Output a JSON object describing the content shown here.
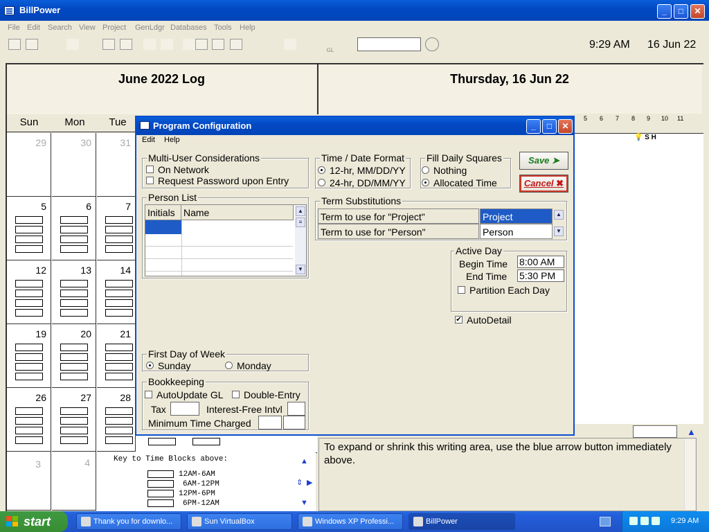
{
  "app": {
    "title": "BillPower",
    "time": "9:29 AM",
    "date": "16 Jun 22"
  },
  "menu": [
    "File",
    "Edit",
    "Search",
    "View",
    "Project",
    "GenLdgr",
    "Databases",
    "Tools",
    "Help"
  ],
  "toolbar": {
    "gl_label": "GL"
  },
  "log": {
    "title": "June 2022 Log"
  },
  "day": {
    "title": "Thursday, 16 Jun 22"
  },
  "weekdays": [
    "Sun",
    "Mon",
    "Tue"
  ],
  "calendar": {
    "row1": [
      "29",
      "30",
      "31"
    ],
    "row2": [
      "5",
      "6",
      "7"
    ],
    "row3": [
      "12",
      "13",
      "14"
    ],
    "row4": [
      "19",
      "20",
      "21"
    ],
    "row5": [
      "26",
      "27",
      "28"
    ],
    "row6": [
      "3",
      "4"
    ]
  },
  "key": {
    "title": "Key to Time Blocks above:",
    "blocks": [
      "12AM-6AM",
      "6AM-12PM",
      "12PM-6PM",
      "6PM-12AM"
    ]
  },
  "hours": [
    "5",
    "6",
    "7",
    "8",
    "9",
    "10",
    "11"
  ],
  "day_icons": "S  H",
  "writing": {
    "hint": "To expand or shrink this writing area, use the blue arrow button immediately above."
  },
  "dialog": {
    "title": "Program Configuration",
    "menu": [
      "Edit",
      "Help"
    ],
    "multi_user": {
      "label": "Multi-User Considerations",
      "on_network": "On Network",
      "request_password": "Request Password upon Entry"
    },
    "time_format": {
      "label": "Time / Date Format",
      "opt1": "12-hr, MM/DD/YY",
      "opt2": "24-hr, DD/MM/YY"
    },
    "fill_squares": {
      "label": "Fill Daily Squares",
      "opt1": "Nothing",
      "opt2": "Allocated Time"
    },
    "buttons": {
      "save": "Save",
      "cancel": "Cancel"
    },
    "person_list": {
      "label": "Person List",
      "col1": "Initials",
      "col2": "Name"
    },
    "terms": {
      "label": "Term Substitutions",
      "rows": [
        {
          "label": "Term to use for \"Project\"",
          "value": "Project"
        },
        {
          "label": "Term to use for \"Person\"",
          "value": "Person"
        }
      ]
    },
    "active_day": {
      "label": "Active Day",
      "begin_label": "Begin Time",
      "begin_value": "8:00 AM",
      "end_label": "End Time",
      "end_value": "5:30 PM",
      "partition": "Partition Each Day"
    },
    "autodetail": "AutoDetail",
    "first_day": {
      "label": "First Day of Week",
      "opt1": "Sunday",
      "opt2": "Monday"
    },
    "bookkeeping": {
      "label": "Bookkeeping",
      "autoupdate": "AutoUpdate GL",
      "double_entry": "Double-Entry",
      "tax": "Tax",
      "interest": "Interest-Free Intvl",
      "min_time": "Minimum Time Charged"
    }
  },
  "taskbar": {
    "start": "start",
    "tasks": [
      "Thank you for downlo...",
      "Sun VirtualBox",
      "Windows XP Professi...",
      "BillPower"
    ],
    "clock": "9:29 AM"
  }
}
